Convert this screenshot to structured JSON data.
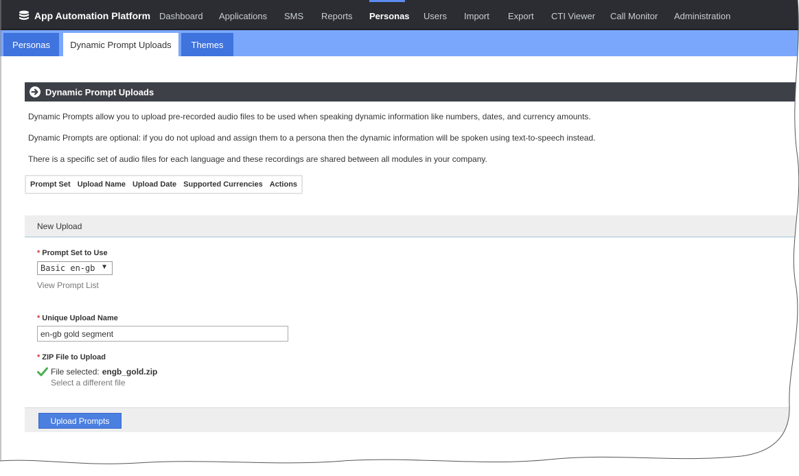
{
  "app": {
    "title": "App Automation Platform"
  },
  "nav": {
    "items": [
      {
        "label": "Dashboard"
      },
      {
        "label": "Applications"
      },
      {
        "label": "SMS"
      },
      {
        "label": "Reports"
      },
      {
        "label": "Personas",
        "active": true
      },
      {
        "label": "Users"
      },
      {
        "label": "Import"
      },
      {
        "label": "Export"
      },
      {
        "label": "CTI Viewer"
      },
      {
        "label": "Call Monitor"
      },
      {
        "label": "Administration"
      }
    ]
  },
  "subtabs": [
    {
      "label": "Personas"
    },
    {
      "label": "Dynamic Prompt Uploads",
      "active": true
    },
    {
      "label": "Themes"
    }
  ],
  "section": {
    "title": "Dynamic Prompt Uploads",
    "paragraphs": [
      "Dynamic Prompts allow you to upload pre-recorded audio files to be used when speaking dynamic information like numbers, dates, and currency amounts.",
      "Dynamic Prompts are optional: if you do not upload and assign them to a persona then the dynamic information will be spoken using text-to-speech instead.",
      "There is a specific set of audio files for each language and these recordings are shared between all modules in your company."
    ],
    "table_headers": [
      "Prompt Set",
      "Upload Name",
      "Upload Date",
      "Supported Currencies",
      "Actions"
    ]
  },
  "new_upload": {
    "title": "New Upload",
    "required_marker": "*",
    "prompt_set_label": "Prompt Set to Use",
    "prompt_set_value": "Basic en-gb",
    "view_prompt_list": "View Prompt List",
    "upload_name_label": "Unique Upload Name",
    "upload_name_value": "en-gb gold segment",
    "zip_label": "ZIP File to Upload",
    "file_selected_prefix": "File selected:",
    "file_name": "engb_gold.zip",
    "select_different": "Select a different file",
    "submit_label": "Upload Prompts"
  },
  "icons": {
    "brand": "database-stack-icon",
    "section": "arrow-circle-right-icon",
    "file_ok": "checkmark-icon",
    "dropdown": "caret-down-icon"
  },
  "colors": {
    "topnav_bg": "#2b2d33",
    "subtab_bar": "#7aa7fb",
    "subtab": "#3f73dd",
    "section_header": "#3d4147",
    "button": "#4b7fe0",
    "required": "#d9342b",
    "check": "#4caf50"
  }
}
